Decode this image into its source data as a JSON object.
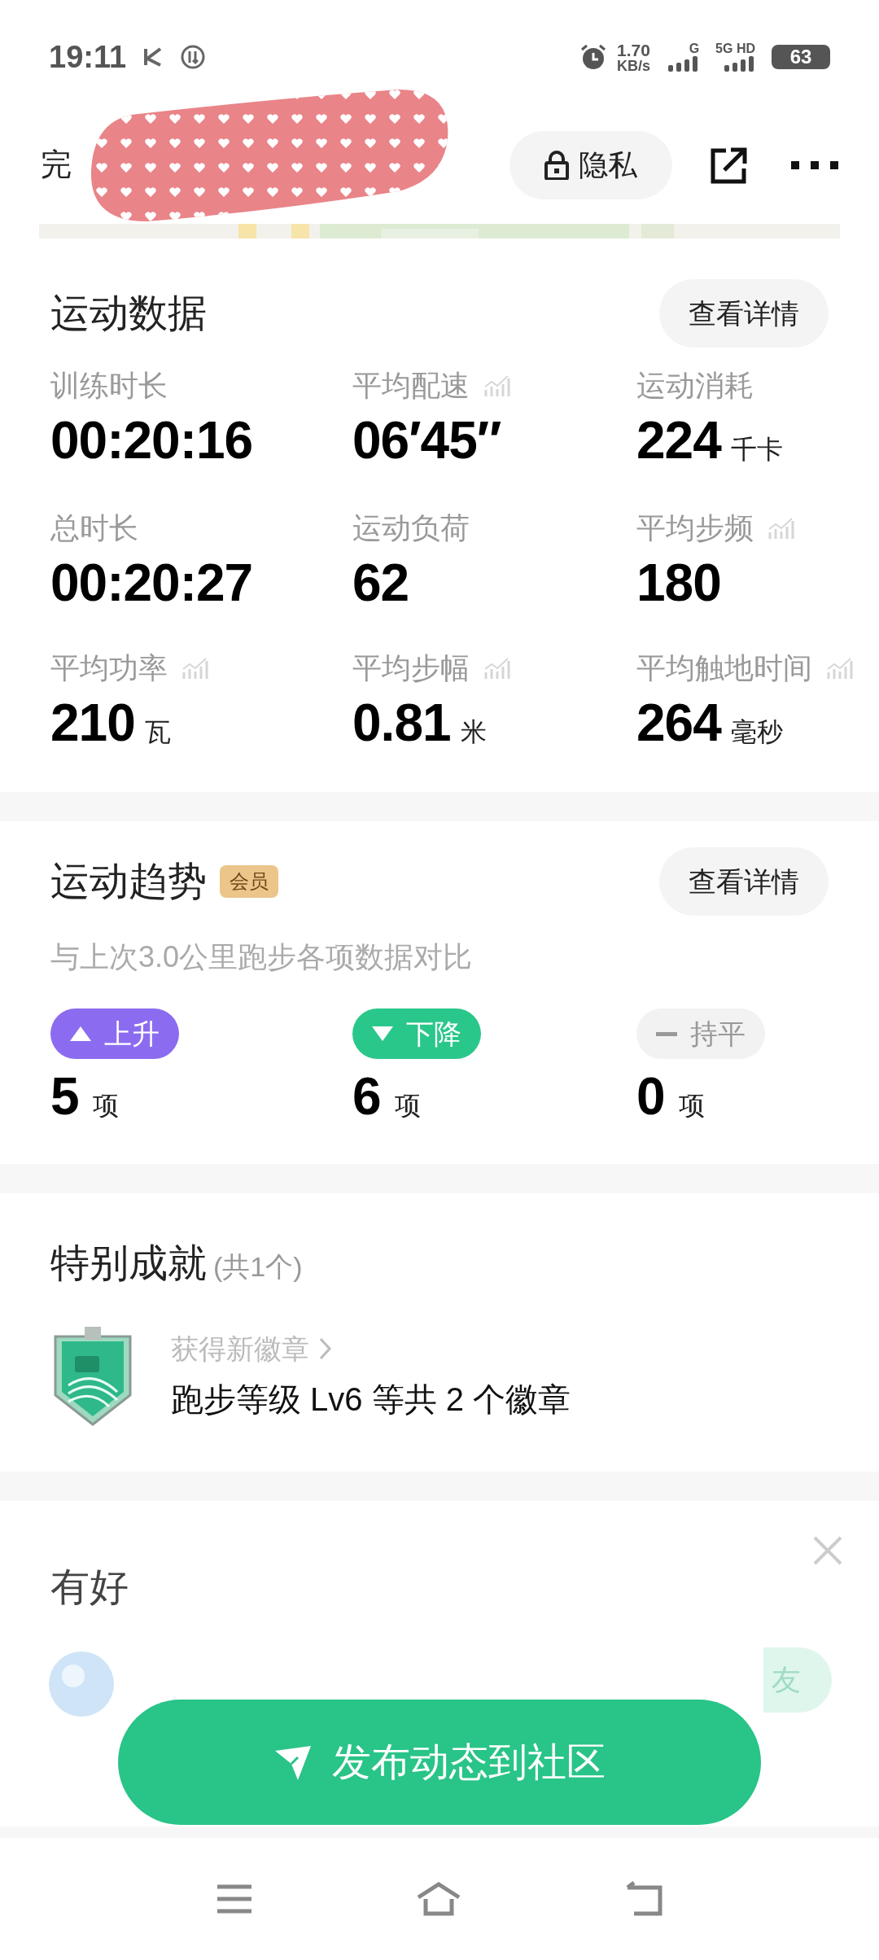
{
  "status_bar": {
    "time": "19:11",
    "speed": "1.70",
    "speed_unit": "KB/s",
    "net1": "G",
    "net2": "5G HD",
    "battery": "63"
  },
  "header": {
    "title": "完",
    "privacy": "隐私"
  },
  "workout_data": {
    "title": "运动数据",
    "details": "查看详情",
    "metrics": [
      {
        "label": "训练时长",
        "value": "00:20:16",
        "trend_icon": false
      },
      {
        "label": "平均配速",
        "value": "06′45″",
        "trend_icon": true
      },
      {
        "label": "运动消耗",
        "value": "224",
        "unit": "千卡",
        "trend_icon": false
      },
      {
        "label": "总时长",
        "value": "00:20:27",
        "trend_icon": false
      },
      {
        "label": "运动负荷",
        "value": "62",
        "trend_icon": false
      },
      {
        "label": "平均步频",
        "value": "180",
        "trend_icon": true
      },
      {
        "label": "平均功率",
        "value": "210",
        "unit": "瓦",
        "trend_icon": true
      },
      {
        "label": "平均步幅",
        "value": "0.81",
        "unit": "米",
        "trend_icon": true
      },
      {
        "label": "平均触地时间",
        "value": "264",
        "unit": "毫秒",
        "trend_icon": true
      }
    ]
  },
  "trend": {
    "title": "运动趋势",
    "badge": "会员",
    "details": "查看详情",
    "subtitle": "与上次3.0公里跑步各项数据对比",
    "items": [
      {
        "kind": "up",
        "label": "上升",
        "color": "#8b6cf0",
        "count": "5",
        "unit": "项"
      },
      {
        "kind": "down",
        "label": "下降",
        "color": "#2ac78a",
        "count": "6",
        "unit": "项"
      },
      {
        "kind": "flat",
        "label": "持平",
        "color": "#f2f2f2",
        "count": "0",
        "unit": "项"
      }
    ]
  },
  "achievement": {
    "title": "特别成就",
    "count": "(共1个)",
    "caption": "获得新徽章",
    "text": "跑步等级 Lv6 等共 2 个徽章"
  },
  "friends": {
    "title": "有好",
    "invite": "友"
  },
  "publish_button": "发布动态到社区"
}
